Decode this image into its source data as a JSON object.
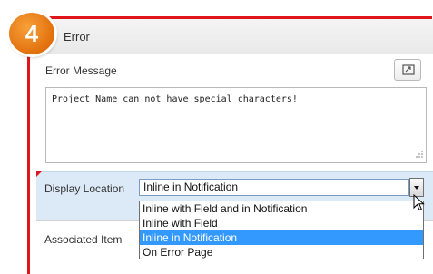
{
  "step": {
    "number": "4"
  },
  "panel": {
    "title": "Error"
  },
  "error_message": {
    "label": "Error Message",
    "value": "Project Name can not have special characters!"
  },
  "display_location": {
    "label": "Display Location",
    "selected": "Inline in Notification",
    "options": [
      "Inline with Field and in Notification",
      "Inline with Field",
      "Inline in Notification",
      "On Error Page"
    ],
    "highlighted_index": 2
  },
  "associated_item": {
    "label": "Associated Item"
  },
  "icons": {
    "expand": "expand-icon",
    "resize": "resize-grip-icon",
    "dropdown": "chevron-down-icon",
    "cursor": "mouse-pointer-icon"
  },
  "colors": {
    "callout_red": "#e0161b",
    "badge_orange": "#e2700c",
    "row_highlight": "#dceaf7",
    "option_selected": "#3399ff"
  }
}
